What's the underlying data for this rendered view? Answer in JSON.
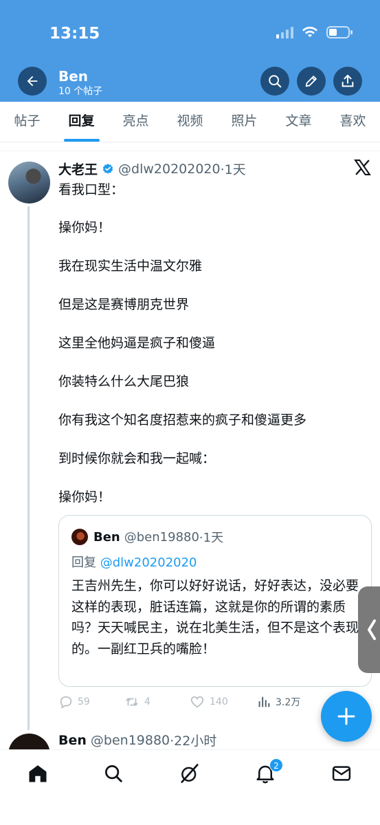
{
  "status_bar": {
    "time": "13:15"
  },
  "header": {
    "name": "Ben",
    "post_count": "10 个帖子"
  },
  "tabs": [
    {
      "label": "帖子"
    },
    {
      "label": "回复",
      "active": true
    },
    {
      "label": "亮点"
    },
    {
      "label": "视频"
    },
    {
      "label": "照片"
    },
    {
      "label": "文章"
    },
    {
      "label": "喜欢"
    }
  ],
  "tweet": {
    "author_name": "大老王",
    "handle": "@dlw20202020",
    "time": "·1天",
    "paragraphs": [
      "看我口型：",
      "操你妈！",
      "我在现实生活中温文尔雅",
      "但是这是赛博朋克世界",
      "这里全他妈逼是疯子和傻逼",
      "你装特么什么大尾巴狼",
      "你有我这个知名度招惹来的疯子和傻逼更多",
      "到时候你就会和我一起喊：",
      "操你妈！"
    ],
    "quote": {
      "author_name": "Ben",
      "handle": "@ben19880",
      "time": "·1天",
      "reply_prefix": "回复",
      "reply_to": "@dlw20202020",
      "text": "王吉州先生，你可以好好说话，好好表达，没必要这样的表现，脏话连篇，这就是你的所谓的素质吗？天天喊民主，说在北美生活，但不是这个表现的。一副红卫兵的嘴脸！"
    },
    "stats": {
      "replies": "59",
      "retweets": "4",
      "likes": "140",
      "views": "3.2万"
    }
  },
  "reply": {
    "author_name": "Ben",
    "handle": "@ben19880",
    "time": "·22小时"
  },
  "notifications_badge": "2",
  "colors": {
    "header_bg": "#4b9be4",
    "accent": "#1d9bf0",
    "text": "#0f1419",
    "muted": "#536471"
  },
  "icons": [
    "back-arrow-icon",
    "search-icon",
    "edit-pencil-icon",
    "share-icon",
    "verified-icon",
    "x-logo-icon",
    "reply-icon",
    "retweet-icon",
    "like-icon",
    "views-icon",
    "plus-icon",
    "chevron-left-icon",
    "home-icon",
    "grok-icon",
    "bell-icon",
    "mail-icon"
  ]
}
